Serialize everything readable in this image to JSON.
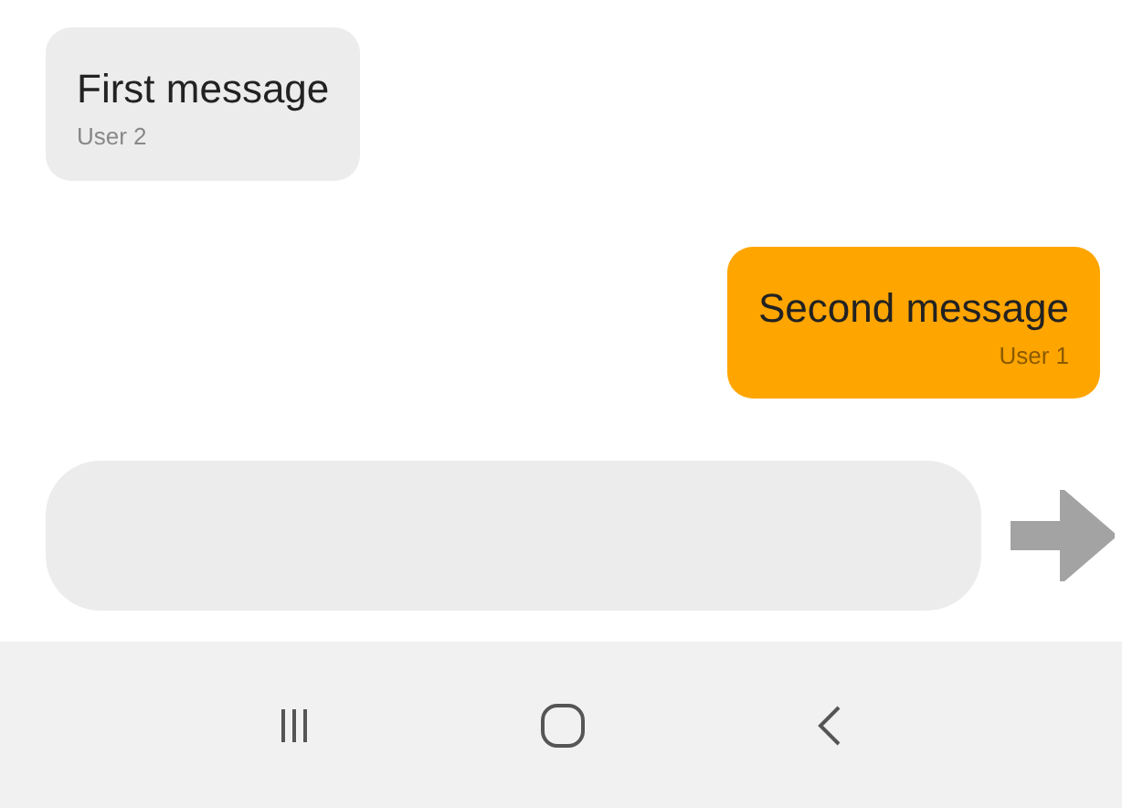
{
  "messages": [
    {
      "kind": "received",
      "text": "First message",
      "sender": "User 2"
    },
    {
      "kind": "sent",
      "text": "Second message",
      "sender": "User 1"
    }
  ]
}
